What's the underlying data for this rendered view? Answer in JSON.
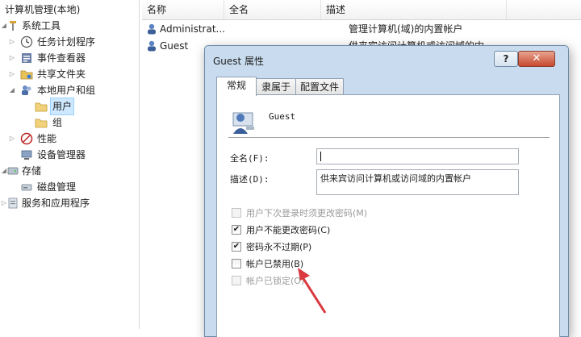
{
  "tree": {
    "items": [
      {
        "label": "计算机管理(本地)",
        "icon": "computer-management-icon"
      },
      {
        "label": "系统工具",
        "icon": "tools-icon"
      },
      {
        "label": "任务计划程序",
        "icon": "clock-icon"
      },
      {
        "label": "事件查看器",
        "icon": "event-viewer-icon"
      },
      {
        "label": "共享文件夹",
        "icon": "shared-folder-icon"
      },
      {
        "label": "本地用户和组",
        "icon": "users-icon"
      },
      {
        "label": "用户",
        "icon": "folder-icon"
      },
      {
        "label": "组",
        "icon": "folder-icon"
      },
      {
        "label": "性能",
        "icon": "performance-icon"
      },
      {
        "label": "设备管理器",
        "icon": "device-manager-icon"
      },
      {
        "label": "存储",
        "icon": "storage-icon"
      },
      {
        "label": "磁盘管理",
        "icon": "disk-icon"
      },
      {
        "label": "服务和应用程序",
        "icon": "services-icon"
      }
    ]
  },
  "list": {
    "columns": [
      "名称",
      "全名",
      "描述"
    ],
    "rows": [
      {
        "name": "Administrat...",
        "fullname": "",
        "description": "管理计算机(域)的内置帐户"
      },
      {
        "name": "Guest",
        "fullname": "",
        "description": "供来宾访问计算机或访问域的内..."
      }
    ]
  },
  "dialog": {
    "title": "Guest 属性",
    "help": "?",
    "close": "✕",
    "tabs": [
      "常规",
      "隶属于",
      "配置文件"
    ],
    "username": "Guest",
    "fullname_label": "全名(F):",
    "fullname_value": "",
    "description_label": "描述(D):",
    "description_value": "供来宾访问计算机或访问域的内置帐户",
    "checkboxes": [
      {
        "label": "用户下次登录时须更改密码(M)",
        "checked": false,
        "disabled": true
      },
      {
        "label": "用户不能更改密码(C)",
        "checked": true,
        "disabled": false
      },
      {
        "label": "密码永不过期(P)",
        "checked": true,
        "disabled": false
      },
      {
        "label": "帐户已禁用(B)",
        "checked": false,
        "disabled": false
      },
      {
        "label": "帐户已锁定(O)",
        "checked": false,
        "disabled": true
      }
    ]
  },
  "colors": {
    "accent_arrow": "#d9393f",
    "selection": "#cde8ff"
  }
}
